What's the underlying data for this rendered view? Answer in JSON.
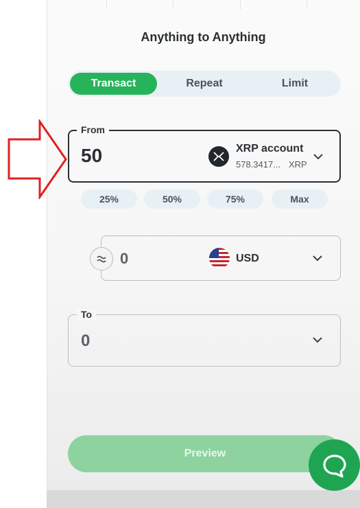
{
  "header": {
    "title": "Anything to Anything"
  },
  "tabs": [
    {
      "label": "Transact",
      "active": true
    },
    {
      "label": "Repeat",
      "active": false
    },
    {
      "label": "Limit",
      "active": false
    }
  ],
  "from": {
    "legend": "From",
    "amount": "50",
    "account_name": "XRP account",
    "balance": "578.3417...",
    "unit": "XRP",
    "icon": "xrp-icon"
  },
  "percent_buttons": [
    "25%",
    "50%",
    "75%",
    "Max"
  ],
  "conversion": {
    "amount": "0",
    "currency": "USD",
    "icon": "us-flag-icon"
  },
  "to": {
    "legend": "To",
    "amount": "0"
  },
  "preview_label": "Preview",
  "colors": {
    "accent": "#27b35a",
    "accent_disabled": "#8ed39f",
    "tab_bg": "#e7f1f5",
    "annotation_arrow": "#e02020",
    "chat": "#1fa552"
  }
}
